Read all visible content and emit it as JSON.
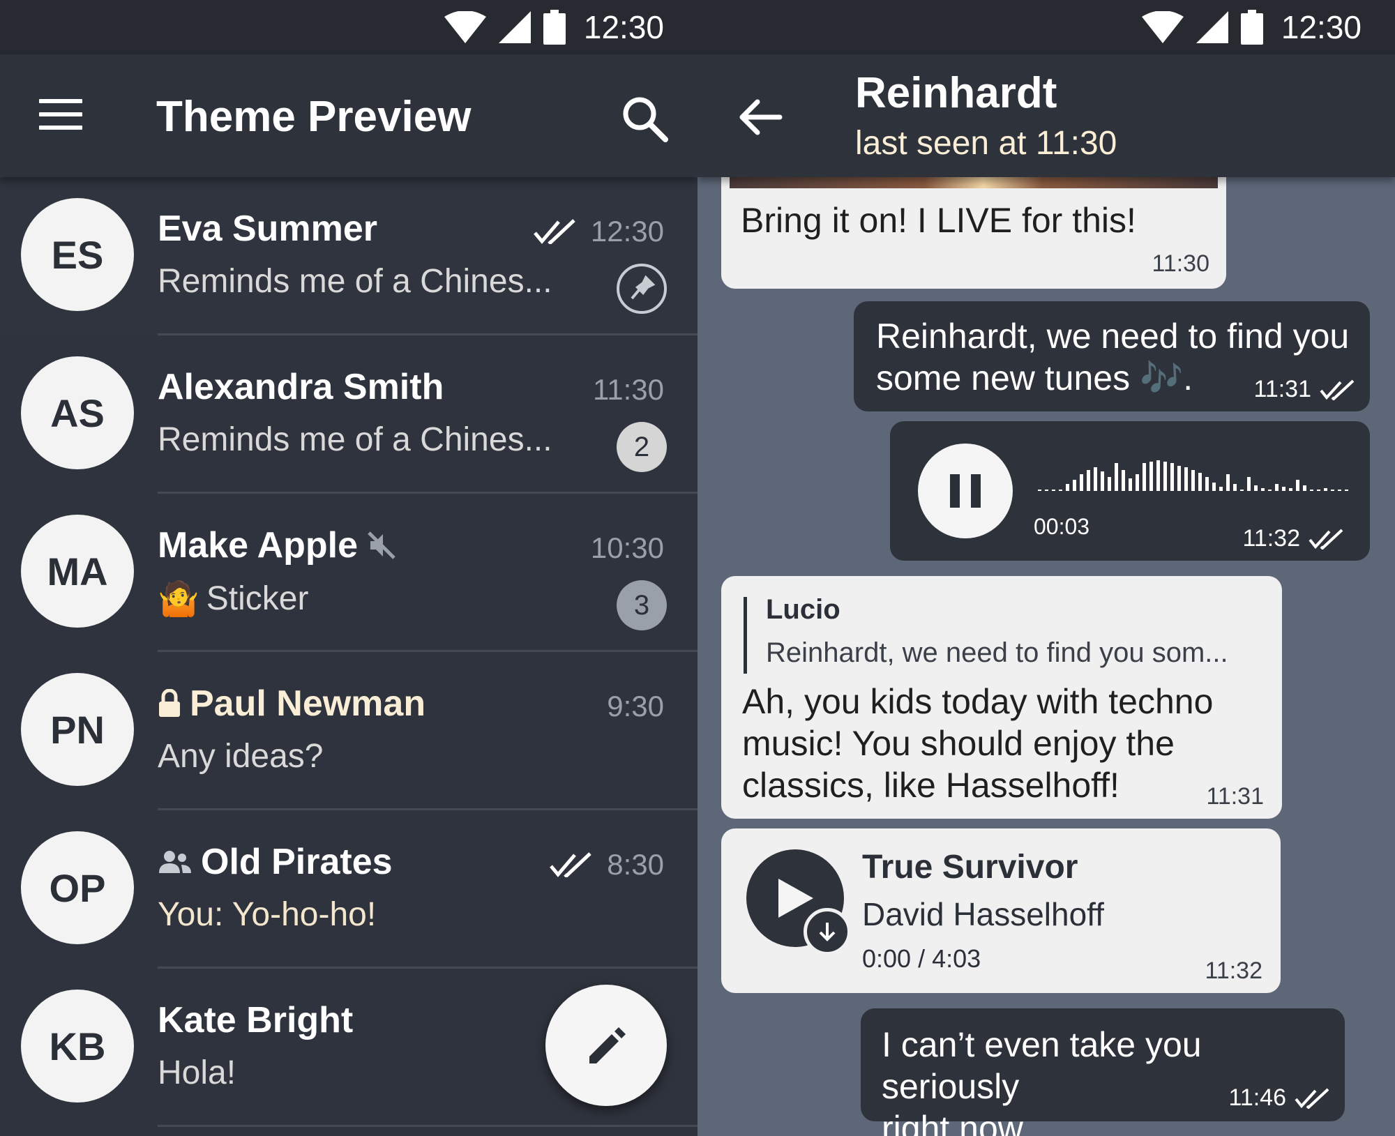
{
  "colors": {
    "left_bg": "#2f333d",
    "right_bg": "#5d6778",
    "toolbar": "#2e323b",
    "status_bar": "#272a31",
    "accent_gold": "#fbeed6",
    "bubble_in": "#f0f0f0",
    "bubble_out": "#2e323b"
  },
  "status_bar": {
    "time_left": "12:30",
    "time_right": "12:30",
    "icons": [
      "wifi-icon",
      "signal-icon",
      "battery-icon"
    ]
  },
  "left_toolbar": {
    "title": "Theme Preview",
    "menu_icon": "menu-icon",
    "search_icon": "search-icon"
  },
  "chats": [
    {
      "initials": "ES",
      "name": "Eva Summer",
      "preview": "Reminds me of a Chines...",
      "time": "12:30",
      "read_receipt": "double-check-icon",
      "indicator": "pin-icon"
    },
    {
      "initials": "AS",
      "name": "Alexandra Smith",
      "preview": "Reminds me of a Chines...",
      "time": "11:30",
      "badge": "2"
    },
    {
      "initials": "MA",
      "name": "Make Apple",
      "name_icon": "muted-icon",
      "preview_emoji": "🤷",
      "preview": "Sticker",
      "time": "10:30",
      "badge": "3"
    },
    {
      "initials": "PN",
      "name": "Paul Newman",
      "name_icon": "lock-icon",
      "preview": "Any ideas?",
      "time": "9:30"
    },
    {
      "initials": "OP",
      "name": "Old Pirates",
      "name_icon": "group-icon",
      "preview": "You: Yo-ho-ho!",
      "time": "8:30",
      "read_receipt": "double-check-icon"
    },
    {
      "initials": "KB",
      "name": "Kate Bright",
      "preview": "Hola!"
    }
  ],
  "fab": {
    "icon": "pencil-icon"
  },
  "conversation": {
    "title": "Reinhardt",
    "subtitle": "last seen at 11:30",
    "back_icon": "back-arrow-icon",
    "messages": [
      {
        "direction": "in",
        "text": "Bring it on! I LIVE for this!",
        "time": "11:30"
      },
      {
        "direction": "out",
        "text_line1": "Reinhardt, we need to find you",
        "text_line2": "some new tunes 🎶.",
        "time": "11:31"
      },
      {
        "direction": "out",
        "type": "voice",
        "duration": "00:03",
        "time": "11:32",
        "progress": 0.0
      },
      {
        "direction": "in",
        "reply_author": "Lucio",
        "reply_text": "Reinhardt, we need to find you som...",
        "text_line1": "Ah, you kids today with techno",
        "text_line2": "music! You should enjoy the",
        "text_line3": "classics, like Hasselhoff!",
        "time": "11:31"
      },
      {
        "direction": "in",
        "type": "audio",
        "track_title": "True Survivor",
        "track_artist": "David Hasselhoff",
        "track_progress": "0:00 / 4:03",
        "time": "11:32"
      },
      {
        "direction": "out",
        "text_line1": "I can’t even take you seriously",
        "text_line2": "right now.",
        "time": "11:46"
      }
    ]
  }
}
